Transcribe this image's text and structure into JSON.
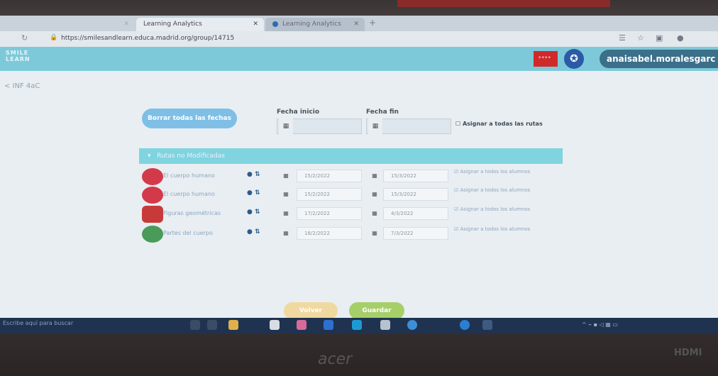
{
  "browser": {
    "tabs": [
      {
        "label": "Learning Analytics"
      },
      {
        "label": "Learning Analytics"
      }
    ],
    "url": "https://smilesandlearn.educa.madrid.org/group/14715"
  },
  "header": {
    "logo": "SMILE\nLEARN",
    "madrid_label": "****",
    "user": "anaisabel.moralesgarc"
  },
  "breadcrumb": "< INF 4aC",
  "controls": {
    "borrar_label": "Borrar todas las fechas",
    "fecha_inicio_label": "Fecha inicio",
    "fecha_fin_label": "Fecha fin",
    "assign_all_label": "Asignar a todas las rutas"
  },
  "section": {
    "label": "Rutas no Modificadas"
  },
  "rows": [
    {
      "name": "El cuerpo humano",
      "start": "15/2/2022",
      "end": "15/3/2022",
      "assign": "Asignar a todos los alumnos",
      "color": "#d23a4a"
    },
    {
      "name": "El cuerpo humano",
      "start": "15/2/2022",
      "end": "15/3/2022",
      "assign": "Asignar a todos los alumnos",
      "color": "#d23a4a"
    },
    {
      "name": "Figuras geométricas",
      "start": "17/2/2022",
      "end": "4/3/2022",
      "assign": "Asignar a todos los alumnos",
      "color": "#c83a3a"
    },
    {
      "name": "Partes del cuerpo",
      "start": "18/2/2022",
      "end": "7/3/2022",
      "assign": "Asignar a todos los alumnos",
      "color": "#4a9a5a"
    }
  ],
  "footer": {
    "volver_label": "Volver",
    "guardar_label": "Guardar"
  },
  "taskbar": {
    "search_placeholder": "Escribe aquí para buscar"
  },
  "laptop": {
    "brand": "acer",
    "port_label": "HDMI"
  }
}
